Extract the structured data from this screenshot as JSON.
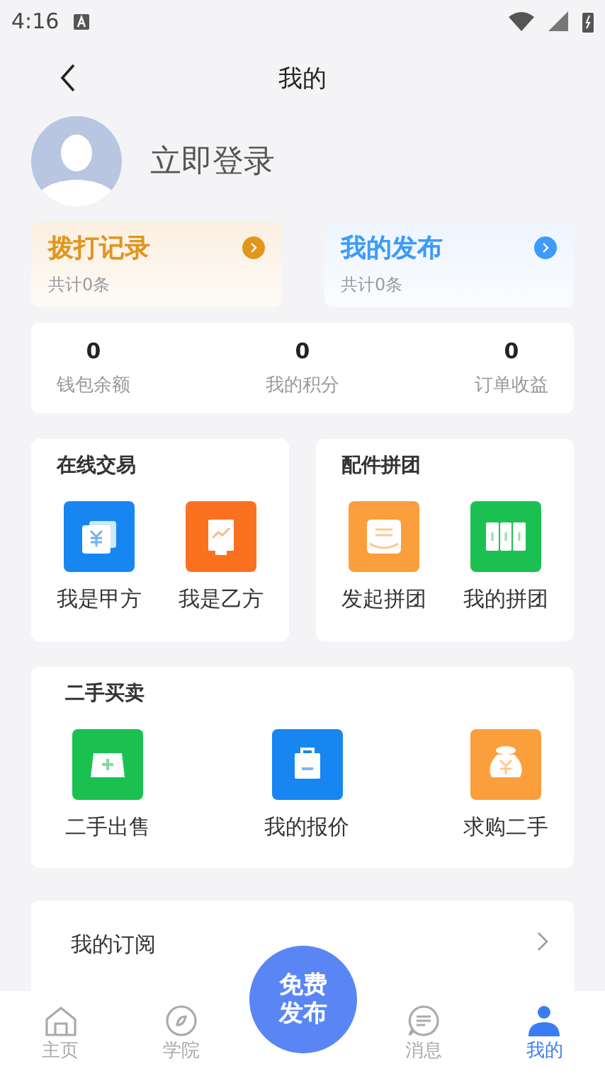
{
  "status_bar": {
    "time": "4:16"
  },
  "header": {
    "title": "我的"
  },
  "profile": {
    "login": "立即登录"
  },
  "quick_cards": [
    {
      "title": "拨打记录",
      "count": "共计0条",
      "color": "#e0961c"
    },
    {
      "title": "我的发布",
      "count": "共计0条",
      "color": "#3d9bfa"
    }
  ],
  "stats": [
    {
      "value": "0",
      "label": "钱包余额"
    },
    {
      "value": "0",
      "label": "我的积分"
    },
    {
      "value": "0",
      "label": "订单收益"
    }
  ],
  "sections": [
    {
      "title": "在线交易",
      "items": [
        {
          "label": "我是甲方",
          "color": "#1786f0"
        },
        {
          "label": "我是乙方",
          "color": "#fc7120"
        }
      ]
    },
    {
      "title": "配件拼团",
      "items": [
        {
          "label": "发起拼团",
          "color": "#fb9f3c"
        },
        {
          "label": "我的拼团",
          "color": "#1bc150"
        }
      ]
    }
  ],
  "second_hand": {
    "title": "二手买卖",
    "items": [
      {
        "label": "二手出售",
        "color": "#1bc150"
      },
      {
        "label": "我的报价",
        "color": "#1786f0"
      },
      {
        "label": "求购二手",
        "color": "#fb9f3c"
      }
    ]
  },
  "menu": [
    {
      "label": "我的订阅"
    }
  ],
  "bottom_nav": {
    "items": [
      {
        "label": "主页",
        "selected": false
      },
      {
        "label": "学院",
        "selected": false
      },
      {
        "label": "消息",
        "selected": false
      },
      {
        "label": "我的",
        "selected": true
      }
    ],
    "publish_button": "免费发布"
  }
}
